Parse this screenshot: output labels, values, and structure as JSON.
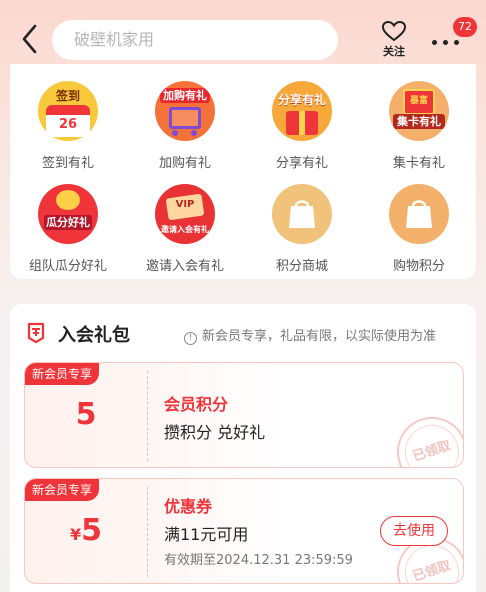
{
  "header": {
    "search_placeholder": "破壁机家用",
    "follow_label": "关注",
    "message_count": "72"
  },
  "gifts": [
    {
      "label": "签到有礼",
      "icon": "checkin-gift-icon",
      "icon_text": "签到",
      "sub_text": "26"
    },
    {
      "label": "加购有礼",
      "icon": "add-cart-gift-icon",
      "icon_text": "加购有礼"
    },
    {
      "label": "分享有礼",
      "icon": "share-gift-icon",
      "icon_text": "分享有礼"
    },
    {
      "label": "集卡有礼",
      "icon": "collect-card-gift-icon",
      "icon_text": "集卡有礼",
      "sub_text": "暴富"
    },
    {
      "label": "组队瓜分好礼",
      "icon": "team-split-gift-icon",
      "icon_text": "瓜分好礼"
    },
    {
      "label": "邀请入会有礼",
      "icon": "invite-join-gift-icon",
      "icon_text": "邀请入会有礼",
      "sub_text": "VIP"
    },
    {
      "label": "积分商城",
      "icon": "points-mall-icon"
    },
    {
      "label": "购物积分",
      "icon": "shopping-points-icon"
    }
  ],
  "membership": {
    "title": "入会礼包",
    "notice": "新会员专享，礼品有限，以实际使用为准",
    "coupons": [
      {
        "tag": "新会员专享",
        "value": "5",
        "name": "会员积分",
        "desc": "攒积分 兑好礼",
        "stamp": "已领取"
      },
      {
        "tag": "新会员专享",
        "currency": "¥",
        "value": "5",
        "name": "优惠券",
        "desc": "满11元可用",
        "expire": "有效期至2024.12.31 23:59:59",
        "button": "去使用",
        "stamp": "已领取"
      }
    ]
  },
  "colors": {
    "accent": "#f0353a",
    "background_top": "#fbd7cf",
    "gold": "#f3b45a"
  }
}
